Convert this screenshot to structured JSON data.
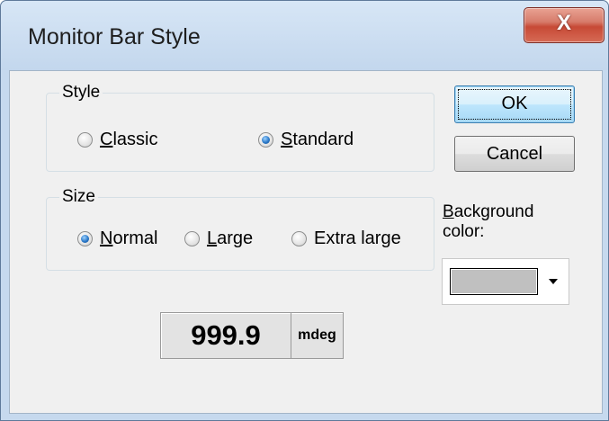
{
  "window": {
    "title": "Monitor Bar Style",
    "close_glyph": "X"
  },
  "style_group": {
    "label": "Style",
    "options": [
      {
        "mnemonic": "C",
        "rest": "lassic",
        "checked": false
      },
      {
        "mnemonic": "S",
        "rest": "tandard",
        "checked": true
      }
    ]
  },
  "size_group": {
    "label": "Size",
    "options": [
      {
        "mnemonic": "N",
        "rest": "ormal",
        "checked": true
      },
      {
        "mnemonic": "L",
        "rest": "arge",
        "checked": false
      },
      {
        "prefix": "E",
        "rest": "xtra large",
        "checked": false
      }
    ]
  },
  "buttons": {
    "ok": "OK",
    "cancel": "Cancel"
  },
  "background": {
    "label_mnemonic": "B",
    "label_rest": "ackground",
    "label_line2": "color:",
    "swatch_color": "#c0c0c0"
  },
  "preview": {
    "value": "999.9",
    "unit": "mdeg"
  },
  "colors": {
    "accent": "#3c7fb1",
    "dialog_bg": "#f0f0f0",
    "title_bg": "#c6d9ee",
    "close_red": "#c74a36"
  }
}
